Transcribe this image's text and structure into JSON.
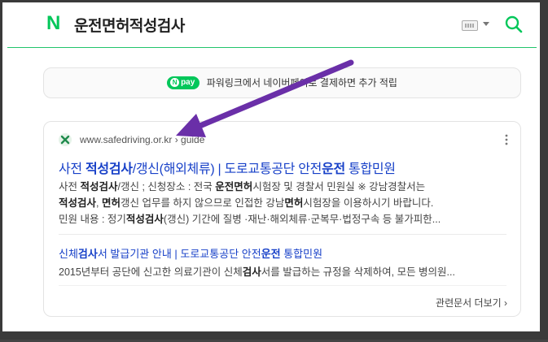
{
  "header": {
    "logo_letter": "N",
    "query": "운전면허적성검사"
  },
  "ad": {
    "npay_label": "pay",
    "npay_letter": "N",
    "text": "파워링크에서 네이버페이로 결제하면 추가 적립"
  },
  "result": {
    "url": "www.safedriving.or.kr › guide",
    "title_parts": [
      "사전 ",
      "적성검사",
      "/갱신(해외체류) | 도로교통공단 안전",
      "운전",
      " 통합민원"
    ],
    "snippet_lines": [
      [
        "사전 ",
        "적성검사",
        "/갱신 ; 신청장소 : 전국 ",
        "운전면허",
        "시험장 및 경찰서 민원실 ※ 강남경찰서는"
      ],
      [
        "",
        "적성검사",
        ", ",
        "면허",
        "갱신 업무를 하지 않으므로 인접한 강남",
        "면허",
        "시험장을 이용하시기 바랍니다."
      ],
      [
        "민원 내용 : 정기",
        "적성검사",
        "(갱신) 기간에 질병 ·재난·해외체류·군복무·법정구속 등 불가피한..."
      ]
    ],
    "sub_title_parts": [
      "신체",
      "검사",
      "서 발급기관 안내 | 도로교통공단 안전",
      "운전",
      " 통합민원"
    ],
    "sub_snippet_parts": [
      "2015년부터 공단에 신고한 의료기관이 신체",
      "검사",
      "서를 발급하는 규정을 삭제하여, 모든 병의원..."
    ],
    "more_docs": "관련문서 더보기"
  },
  "annotation": {
    "color": "#6a2fa8"
  }
}
